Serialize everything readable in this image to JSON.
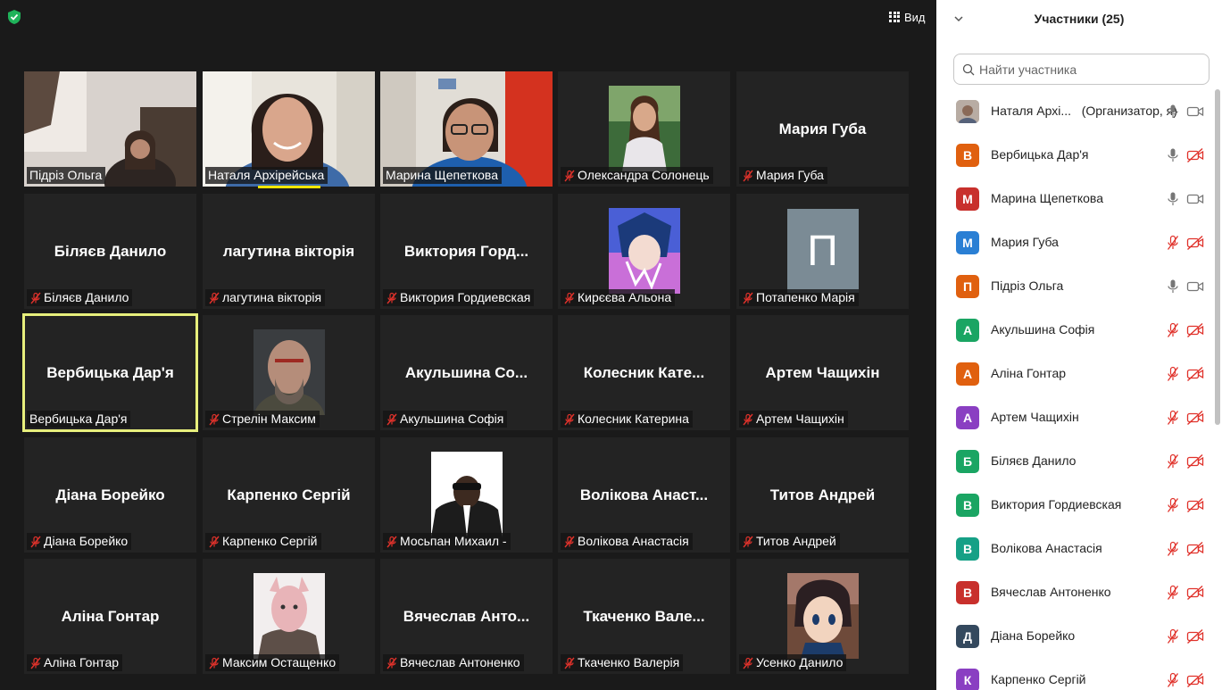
{
  "toolbar": {
    "view_label": "Вид"
  },
  "tiles": [
    {
      "label": "Підріз Ольга",
      "type": "camera"
    },
    {
      "label": "Наталя Архірейська",
      "type": "camera"
    },
    {
      "label": "Марина Щепеткова",
      "type": "camera"
    },
    {
      "label": "Олександра Солонець",
      "type": "photo",
      "muted": true
    },
    {
      "name": "Мария Губа",
      "label": "Мария Губа",
      "type": "name",
      "muted": true
    },
    {
      "name": "Біляєв Данило",
      "label": "Біляєв Данило",
      "type": "name",
      "muted": true
    },
    {
      "name": "лагутина вікторія",
      "label": "лагутина вікторія",
      "type": "name",
      "muted": true
    },
    {
      "name": "Виктория  Горд...",
      "label": "Виктория Гордиевская",
      "type": "name",
      "muted": true
    },
    {
      "label": "Кирєєва Альона",
      "type": "photo",
      "muted": true
    },
    {
      "label": "Потапенко Марія",
      "type": "letter",
      "letter": "П",
      "muted": true
    },
    {
      "name": "Вербицька Дар'я",
      "label": "Вербицька Дар'я",
      "type": "name",
      "speaking": true
    },
    {
      "label": "Стрелін Максим",
      "type": "photo",
      "muted": true
    },
    {
      "name": "Акульшина  Со...",
      "label": "Акульшина Софія",
      "type": "name",
      "muted": true
    },
    {
      "name": "Колесник  Кате...",
      "label": "Колесник Катерина",
      "type": "name",
      "muted": true
    },
    {
      "name": "Артем Чащихін",
      "label": "Артем Чащихін",
      "type": "name",
      "muted": true
    },
    {
      "name": "Діана Борейко",
      "label": "Діана Борейко",
      "type": "name",
      "muted": true
    },
    {
      "name": "Карпенко Сергій",
      "label": "Карпенко Сергій",
      "type": "name",
      "muted": true
    },
    {
      "label": "Мосьпан Михаил -",
      "type": "photo",
      "muted": true
    },
    {
      "name": "Волікова  Анаст...",
      "label": "Волікова Анастасія",
      "type": "name",
      "muted": true
    },
    {
      "name": "Титов Андрей",
      "label": "Титов Андрей",
      "type": "name",
      "muted": true
    },
    {
      "name": "Аліна Гонтар",
      "label": "Аліна Гонтар",
      "type": "name",
      "muted": true
    },
    {
      "label": "Максим Остащенко",
      "type": "photo",
      "muted": true
    },
    {
      "name": "Вячеслав  Анто...",
      "label": "Вячеслав Антоненко",
      "type": "name",
      "muted": true
    },
    {
      "name": "Ткаченко  Вале...",
      "label": "Ткаченко Валерія",
      "type": "name",
      "muted": true
    },
    {
      "label": "Усенко Данило",
      "type": "photo",
      "muted": true
    }
  ],
  "panel": {
    "title": "Участники (25)",
    "search_placeholder": "Найти участника",
    "participants": [
      {
        "name": "Наталя Архі...",
        "role": "(Организатор, я)",
        "avatar": "photo",
        "mic": "on",
        "video": "on"
      },
      {
        "name": "Вербицька Дар'я",
        "avatar": "В",
        "color": "#e0600f",
        "mic": "on",
        "video": "off"
      },
      {
        "name": "Марина Щепеткова",
        "avatar": "М",
        "color": "#c8302c",
        "mic": "on",
        "video": "on"
      },
      {
        "name": "Мария Губа",
        "avatar": "М",
        "color": "#2a7fd4",
        "mic": "off",
        "video": "off"
      },
      {
        "name": "Підріз Ольга",
        "avatar": "П",
        "color": "#e0600f",
        "mic": "on",
        "video": "on"
      },
      {
        "name": "Акульшина Софія",
        "avatar": "А",
        "color": "#1aa563",
        "mic": "off",
        "video": "off"
      },
      {
        "name": "Аліна Гонтар",
        "avatar": "А",
        "color": "#e0600f",
        "mic": "off",
        "video": "off"
      },
      {
        "name": "Артем Чащихін",
        "avatar": "А",
        "color": "#8a3fc2",
        "mic": "off",
        "video": "off"
      },
      {
        "name": "Біляєв Данило",
        "avatar": "Б",
        "color": "#1aa563",
        "mic": "off",
        "video": "off"
      },
      {
        "name": "Виктория Гордиевская",
        "avatar": "В",
        "color": "#1aa563",
        "mic": "off",
        "video": "off"
      },
      {
        "name": "Волікова Анастасія",
        "avatar": "В",
        "color": "#16a086",
        "mic": "off",
        "video": "off"
      },
      {
        "name": "Вячеслав Антоненко",
        "avatar": "В",
        "color": "#c8302c",
        "mic": "off",
        "video": "off"
      },
      {
        "name": "Діана Борейко",
        "avatar": "Д",
        "color": "#34495e",
        "mic": "off",
        "video": "off"
      },
      {
        "name": "Карпенко Сергій",
        "avatar": "К",
        "color": "#8a3fc2",
        "mic": "off",
        "video": "off"
      }
    ]
  },
  "colors": {
    "speaker_outline": "#e7ef7c",
    "muted_red": "#e0322b",
    "bg": "#1a1a1a",
    "tile_bg": "#232323"
  }
}
